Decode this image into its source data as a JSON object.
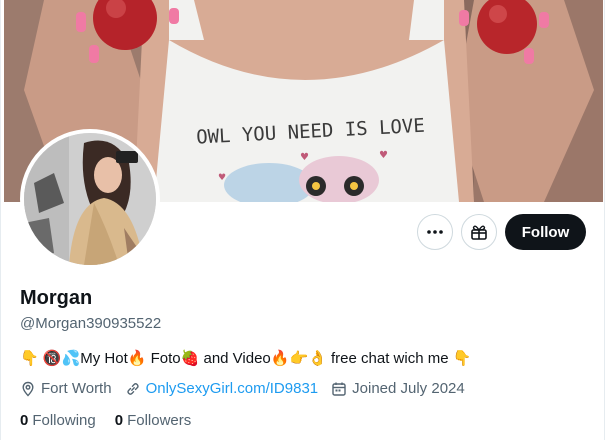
{
  "profile": {
    "display_name": "Morgan",
    "handle": "@Morgan390935522",
    "bio_parts": {
      "e1": "👇",
      "e2": "🔞",
      "e3": "💦",
      "t1": "My Hot",
      "e4": "🔥",
      "t2": " Foto",
      "e5": "🍓",
      "t3": " and Video",
      "e6": "🔥",
      "e7": " 👉",
      "e8": "👌",
      "t4": " free chat wich me ",
      "e9": "👇"
    },
    "location": "Fort Worth",
    "website": "OnlySexyGirl.com/ID9831",
    "joined": "Joined July 2024",
    "following_count": "0",
    "following_label": "Following",
    "followers_count": "0",
    "followers_label": "Followers"
  },
  "actions": {
    "follow_label": "Follow",
    "more_icon": "more-icon",
    "gift_icon": "gift-icon"
  },
  "banner": {
    "shirt_text": "OWL YOU NEED IS LOVE"
  },
  "colors": {
    "accent": "#1d9bf0",
    "button_dark": "#0f1419",
    "secondary_text": "#536471",
    "border": "#cfd9de"
  }
}
